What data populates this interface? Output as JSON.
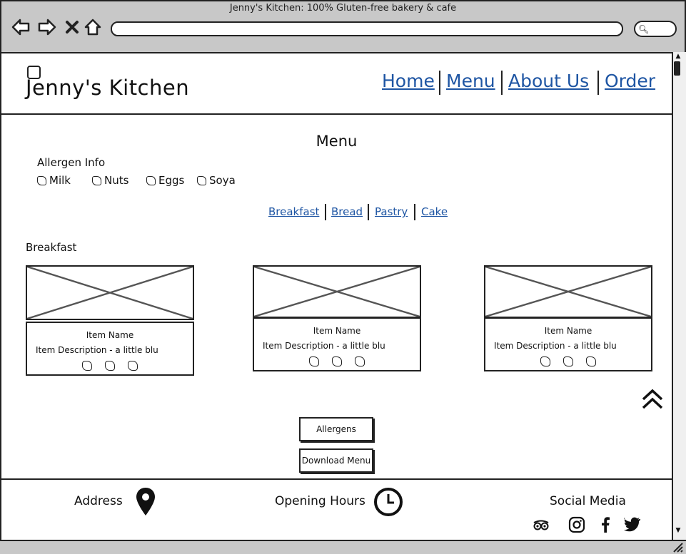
{
  "window": {
    "title": "Jenny's Kitchen: 100% Gluten-free bakery & cafe"
  },
  "header": {
    "site_title": "Jenny's Kitchen",
    "nav": [
      "Home",
      "Menu",
      "About Us",
      "Order"
    ]
  },
  "menu": {
    "heading": "Menu",
    "allergen_label": "Allergen Info",
    "allergens": [
      "Milk",
      "Nuts",
      "Eggs",
      "Soya"
    ],
    "categories": [
      "Breakfast",
      "Bread",
      "Pastry",
      "Cake"
    ],
    "section_label": "Breakfast",
    "items": [
      {
        "name": "Item Name",
        "description": "Item Description - a little blur"
      },
      {
        "name": "Item Name",
        "description": "Item Description - a little blur"
      },
      {
        "name": "Item Name",
        "description": "Item Description - a little blur"
      }
    ],
    "buttons": {
      "allergens": "Allergens",
      "download": "Download Menu"
    }
  },
  "footer": {
    "address": "Address",
    "opening_hours": "Opening Hours",
    "social_media": "Social Media",
    "social_icons": [
      "tripadvisor-icon",
      "instagram-icon",
      "facebook-icon",
      "twitter-icon"
    ]
  },
  "colors": {
    "link": "#1e55a3",
    "chrome": "#c8c8c8",
    "ink": "#222222"
  }
}
